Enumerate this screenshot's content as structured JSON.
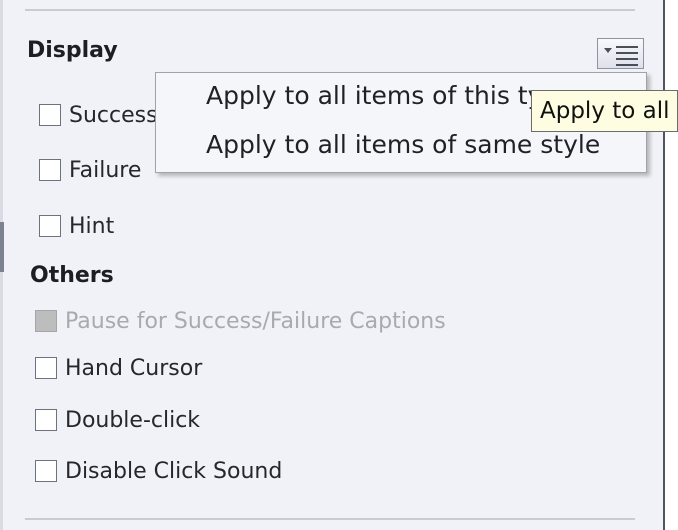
{
  "display": {
    "heading": "Display",
    "options_icon": "list-options-icon",
    "checkboxes": [
      {
        "label": "Success",
        "checked": false
      },
      {
        "label": "Failure",
        "checked": false
      },
      {
        "label": "Hint",
        "checked": false
      }
    ]
  },
  "context_menu": {
    "items": [
      "Apply to all items of this type",
      "Apply to all items of same style"
    ]
  },
  "tooltip": {
    "text": "Apply to all"
  },
  "others": {
    "heading": "Others",
    "checkboxes": [
      {
        "label": "Pause for Success/Failure Captions",
        "checked": false,
        "disabled": true
      },
      {
        "label": "Hand Cursor",
        "checked": false,
        "disabled": false
      },
      {
        "label": "Double-click",
        "checked": false,
        "disabled": false
      },
      {
        "label": "Disable Click Sound",
        "checked": false,
        "disabled": false
      }
    ]
  }
}
